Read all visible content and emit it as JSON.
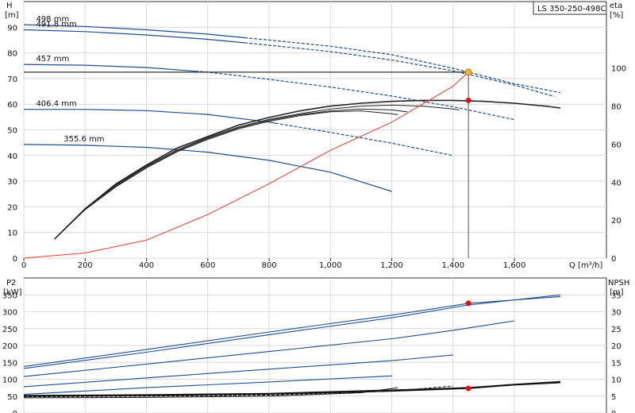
{
  "product_label": "LS 350-250-498C",
  "chart_data": [
    {
      "type": "line",
      "panel": "head-efficiency",
      "xlabel": "Q [m³/h]",
      "ylabel": "H",
      "ylabel_unit": "[m]",
      "ylabel2": "eta",
      "ylabel2_unit": "[%]",
      "xlim": [
        0,
        1900
      ],
      "ylim": [
        0,
        100
      ],
      "y2lim": [
        0,
        135
      ],
      "xticks": [
        0,
        200,
        400,
        600,
        800,
        1000,
        1200,
        1400,
        1600
      ],
      "xtick_labels": [
        "0",
        "200",
        "400",
        "600",
        "800",
        "1,000",
        "1,200",
        "1,400",
        "1,600"
      ],
      "yticks": [
        0,
        10,
        20,
        30,
        40,
        50,
        60,
        70,
        80,
        90
      ],
      "y2ticks": [
        0,
        20,
        40,
        60,
        80,
        100
      ],
      "grid": true,
      "head_curves": [
        {
          "name": "498 mm",
          "color": "#1f4e8c",
          "solid_until": 720,
          "points": [
            [
              0,
              91
            ],
            [
              200,
              90.3
            ],
            [
              400,
              89
            ],
            [
              600,
              87.3
            ],
            [
              800,
              85
            ],
            [
              1000,
              82.6
            ],
            [
              1200,
              79.3
            ],
            [
              1400,
              74
            ],
            [
              1600,
              68
            ],
            [
              1750,
              64.5
            ]
          ]
        },
        {
          "name": "491.8 mm",
          "color": "#1f4e8c",
          "solid_until": 720,
          "points": [
            [
              0,
              89
            ],
            [
              200,
              88.3
            ],
            [
              400,
              87
            ],
            [
              600,
              85.3
            ],
            [
              800,
              83
            ],
            [
              1000,
              80.5
            ],
            [
              1200,
              77.2
            ],
            [
              1400,
              73
            ],
            [
              1600,
              67.5
            ],
            [
              1730,
              63
            ]
          ]
        },
        {
          "name": "457 mm",
          "color": "#1f4e8c",
          "solid_until": 560,
          "points": [
            [
              0,
              75.5
            ],
            [
              200,
              75.2
            ],
            [
              400,
              74.3
            ],
            [
              600,
              72.5
            ],
            [
              800,
              69.7
            ],
            [
              1000,
              66.7
            ],
            [
              1200,
              63.2
            ],
            [
              1400,
              59
            ],
            [
              1600,
              54
            ]
          ]
        },
        {
          "name": "406.4 mm",
          "color": "#1f4e8c",
          "solid_until": 820,
          "points": [
            [
              0,
              58
            ],
            [
              200,
              58
            ],
            [
              400,
              57.5
            ],
            [
              600,
              56
            ],
            [
              800,
              53
            ],
            [
              1000,
              49
            ],
            [
              1200,
              44.8
            ],
            [
              1400,
              40
            ]
          ]
        },
        {
          "name": "355.6 mm",
          "color": "#1f4e8c",
          "solid_until": 1220,
          "points": [
            [
              0,
              44.3
            ],
            [
              200,
              44
            ],
            [
              400,
              43.2
            ],
            [
              600,
              41.3
            ],
            [
              800,
              38.1
            ],
            [
              1000,
              33.5
            ],
            [
              1200,
              26
            ]
          ]
        }
      ],
      "efficiency_curves": [
        {
          "name": "",
          "points": [
            [
              100,
              10
            ],
            [
              200,
              26
            ],
            [
              300,
              39
            ],
            [
              400,
              49
            ],
            [
              500,
              58
            ],
            [
              600,
              64
            ],
            [
              700,
              70
            ],
            [
              800,
              74
            ],
            [
              900,
              77.5
            ],
            [
              1000,
              80
            ],
            [
              1100,
              81.5
            ],
            [
              1200,
              82.5
            ],
            [
              1300,
              83
            ],
            [
              1400,
              83
            ],
            [
              1500,
              82.5
            ],
            [
              1600,
              81.5
            ],
            [
              1700,
              80
            ],
            [
              1750,
              79
            ]
          ]
        },
        {
          "name": "",
          "points": [
            [
              100,
              10
            ],
            [
              200,
              26
            ],
            [
              300,
              38.5
            ],
            [
              400,
              48.5
            ],
            [
              500,
              57
            ],
            [
              600,
              63.5
            ],
            [
              700,
              69
            ],
            [
              800,
              73
            ],
            [
              900,
              76
            ],
            [
              1000,
              78.5
            ],
            [
              1100,
              80
            ],
            [
              1200,
              80.5
            ],
            [
              1300,
              80
            ],
            [
              1400,
              78.5
            ],
            [
              1420,
              78
            ]
          ]
        },
        {
          "name": "",
          "points": [
            [
              100,
              10
            ],
            [
              200,
              26
            ],
            [
              300,
              38
            ],
            [
              400,
              48
            ],
            [
              500,
              56.5
            ],
            [
              600,
              63
            ],
            [
              700,
              68.5
            ],
            [
              800,
              72.5
            ],
            [
              900,
              75.5
            ],
            [
              1000,
              77.5
            ],
            [
              1100,
              78.5
            ],
            [
              1200,
              78
            ],
            [
              1250,
              77
            ]
          ]
        },
        {
          "name": "",
          "points": [
            [
              100,
              10
            ],
            [
              200,
              25.5
            ],
            [
              300,
              37.5
            ],
            [
              400,
              47.5
            ],
            [
              500,
              56
            ],
            [
              600,
              62.5
            ],
            [
              700,
              68
            ],
            [
              800,
              72
            ],
            [
              900,
              75
            ],
            [
              1000,
              77
            ],
            [
              1100,
              77.5
            ],
            [
              1200,
              76
            ],
            [
              1220,
              75.5
            ]
          ]
        }
      ],
      "system_curve": {
        "name": "",
        "color": "#e23b2e",
        "points": [
          [
            0,
            0
          ],
          [
            200,
            2
          ],
          [
            400,
            7
          ],
          [
            600,
            17
          ],
          [
            800,
            29
          ],
          [
            1000,
            42
          ],
          [
            1200,
            53
          ],
          [
            1300,
            60
          ],
          [
            1400,
            67
          ],
          [
            1450,
            72.5
          ]
        ]
      },
      "duty_line": {
        "name": "",
        "y": 72.5
      },
      "duty_point": {
        "name": "",
        "x": 1450,
        "y": 72.5,
        "color": "#f5b820"
      },
      "efficiency_point": {
        "name": "",
        "x": 1450,
        "y2": 83,
        "color": "#e01010"
      }
    },
    {
      "type": "line",
      "panel": "power-npsh",
      "ylabel": "P2",
      "ylabel_unit": "[kW]",
      "ylabel2": "NPSH",
      "ylabel2_unit": "[m]",
      "xlim": [
        0,
        1900
      ],
      "ylim": [
        0,
        400
      ],
      "y2lim": [
        0,
        40
      ],
      "yticks": [
        0,
        50,
        100,
        150,
        200,
        250,
        300,
        350
      ],
      "y2ticks": [
        0,
        5,
        10,
        15,
        20,
        25,
        30,
        35
      ],
      "grid": true,
      "power_curves": [
        {
          "name": "",
          "points": [
            [
              0,
              138
            ],
            [
              400,
              188
            ],
            [
              800,
              240
            ],
            [
              1200,
              290
            ],
            [
              1450,
              325
            ],
            [
              1750,
              345
            ]
          ]
        },
        {
          "name": "",
          "points": [
            [
              0,
              132
            ],
            [
              400,
              180
            ],
            [
              800,
              232
            ],
            [
              1200,
              282
            ],
            [
              1450,
              320
            ],
            [
              1750,
              350
            ]
          ]
        },
        {
          "name": "",
          "points": [
            [
              0,
              108
            ],
            [
              400,
              145
            ],
            [
              800,
              182
            ],
            [
              1200,
              220
            ],
            [
              1400,
              245
            ],
            [
              1600,
              273
            ]
          ]
        },
        {
          "name": "",
          "points": [
            [
              0,
              78
            ],
            [
              400,
              104
            ],
            [
              800,
              130
            ],
            [
              1200,
              155
            ],
            [
              1400,
              172
            ]
          ]
        },
        {
          "name": "",
          "points": [
            [
              0,
              55
            ],
            [
              400,
              75
            ],
            [
              800,
              92
            ],
            [
              1200,
              110
            ]
          ]
        }
      ],
      "npsh_curves": [
        {
          "name": "",
          "points": [
            [
              0,
              4.5
            ],
            [
              400,
              4.6
            ],
            [
              800,
              5
            ],
            [
              1100,
              6
            ],
            [
              1220,
              7.5
            ]
          ]
        },
        {
          "name": "",
          "points": [
            [
              0,
              4.8
            ],
            [
              400,
              5
            ],
            [
              800,
              5.3
            ],
            [
              1200,
              6.5
            ],
            [
              1400,
              8
            ]
          ]
        },
        {
          "name": "",
          "points": [
            [
              0,
              5
            ],
            [
              400,
              5.2
            ],
            [
              800,
              5.6
            ],
            [
              1200,
              6.5
            ],
            [
              1450,
              7.3
            ],
            [
              1600,
              8.3
            ],
            [
              1750,
              9
            ]
          ]
        },
        {
          "name": "",
          "points": [
            [
              0,
              5.2
            ],
            [
              400,
              5.4
            ],
            [
              800,
              5.8
            ],
            [
              1200,
              6.8
            ],
            [
              1450,
              7.5
            ],
            [
              1600,
              8.5
            ],
            [
              1750,
              9.3
            ]
          ]
        }
      ],
      "power_point": {
        "name": "",
        "x": 1450,
        "y": 325,
        "color": "#e01010"
      },
      "npsh_point": {
        "name": "",
        "x": 1450,
        "y2": 7.3,
        "color": "#e01010"
      }
    }
  ]
}
